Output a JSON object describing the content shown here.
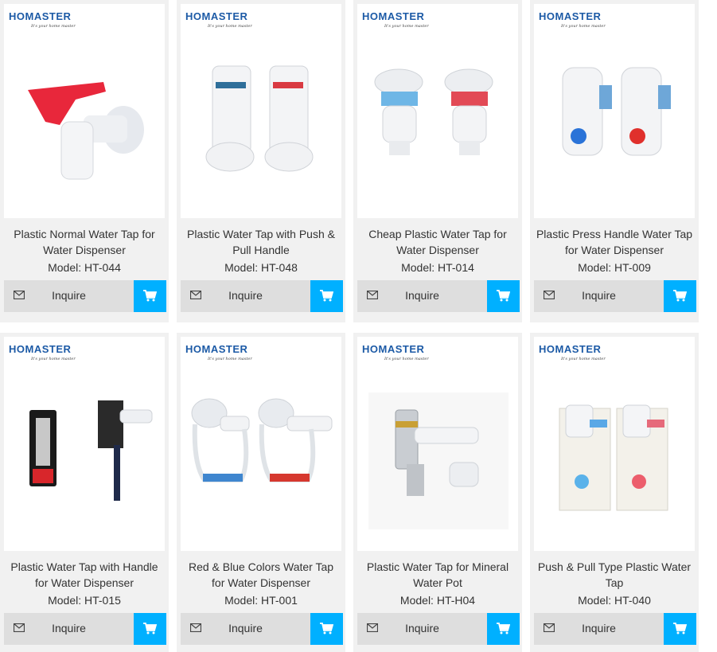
{
  "brand": {
    "logo_text": "HOMASTER",
    "tagline": "It's your home master"
  },
  "colors": {
    "accent": "#00b0ff",
    "inquire_bg": "#dedede",
    "card_bg": "#f1f1f1",
    "brand_blue": "#1c5aa6"
  },
  "icons": {
    "inquire": "envelope-icon",
    "cart": "shopping-cart-icon"
  },
  "products": [
    {
      "title": "Plastic Normal Water Tap for Water Dispenser",
      "model": "Model: HT-044",
      "inquire_label": "Inquire"
    },
    {
      "title": "Plastic Water Tap with Push & Pull Handle",
      "model": "Model: HT-048",
      "inquire_label": "Inquire"
    },
    {
      "title": "Cheap Plastic Water Tap for Water Dispenser",
      "model": "Model: HT-014",
      "inquire_label": "Inquire"
    },
    {
      "title": "Plastic Press Handle Water Tap for Water Dispenser",
      "model": "Model: HT-009",
      "inquire_label": "Inquire"
    },
    {
      "title": "Plastic Water Tap with Handle for Water Dispenser",
      "model": "Model: HT-015",
      "inquire_label": "Inquire"
    },
    {
      "title": "Red & Blue Colors Water Tap for Water Dispenser",
      "model": "Model: HT-001",
      "inquire_label": "Inquire"
    },
    {
      "title": "Plastic Water Tap for Mineral Water Pot",
      "model": "Model: HT-H04",
      "inquire_label": "Inquire"
    },
    {
      "title": "Push & Pull Type Plastic Water Tap",
      "model": "Model: HT-040",
      "inquire_label": "Inquire"
    }
  ]
}
